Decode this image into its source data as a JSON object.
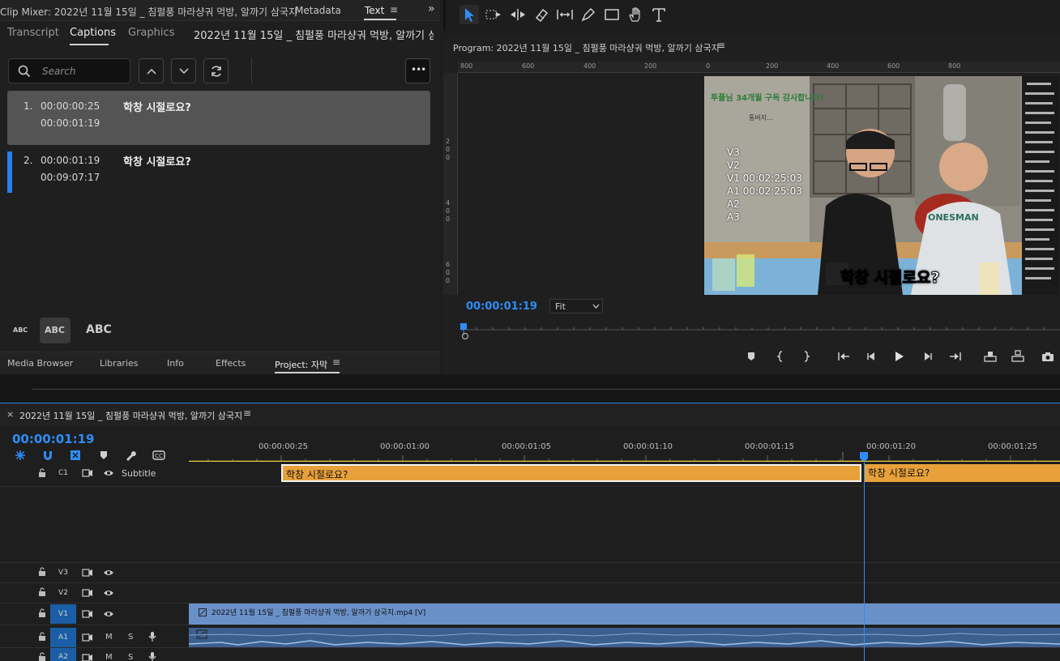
{
  "top_tabs": {
    "clip_mixer": "Clip Mixer: 2022년 11월 15일 _ 침펄풍 마라샹궈 먹방, 알까기 삼국지",
    "metadata": "Metadata",
    "text": "Text",
    "menu_icon": "≡",
    "expand_icon": "»"
  },
  "text_panel": {
    "tabs": [
      "Transcript",
      "Captions",
      "Graphics"
    ],
    "sequence_title": "2022년 11월 15일 _ 침펄풍 마라샹궈 먹방, 알까기 삼...",
    "search_placeholder": "Search",
    "captions": [
      {
        "num": "1.",
        "in": "00:00:00:25",
        "out": "00:00:01:19",
        "text": "학창 시절로요?"
      },
      {
        "num": "2.",
        "in": "00:00:01:19",
        "out": "00:09:07:17",
        "text": "학창 시절로요?"
      }
    ],
    "abc_sizes": [
      "ABC",
      "ABC",
      "ABC"
    ],
    "more": "•••"
  },
  "bottom_tabs": [
    "Media Browser",
    "Libraries",
    "Info",
    "Effects",
    "Project: 자막"
  ],
  "program": {
    "title": "Program: 2022년 11월 15일 _ 침펄풍 마라샹궈 먹방, 알까기 삼국지",
    "ruler_top": [
      "800",
      "600",
      "400",
      "200",
      "0",
      "200",
      "400",
      "600",
      "800"
    ],
    "ruler_left": [
      "2",
      "0",
      "0",
      "4",
      "0",
      "0",
      "6",
      "0",
      "0"
    ],
    "timecode": "00:00:01:19",
    "fit": "Fit",
    "overlay_lines": [
      "V3",
      "V2",
      "V1 00:02:25:03",
      "A1 00:02:25:03",
      "A2",
      "A3"
    ],
    "video_caption": "학창 시절로요?",
    "video_banner": "투플님 34개월 구독 감사합니다!",
    "video_banner_sub": "통버지...",
    "shirt_text": "ONESMAN"
  },
  "timeline": {
    "title": "2022년 11월 15일 _ 침펄풍 마라샹궈 먹방, 알까기 삼국지",
    "close": "×",
    "menu": "≡",
    "timecode": "00:00:01:19",
    "ruler_labels": [
      "00:00:00:25",
      "00:00:01:00",
      "00:00:01:05",
      "00:00:01:10",
      "00:00:01:15",
      "00:00:01:20",
      "00:00:01:25"
    ],
    "subtitle_track": {
      "id": "C1",
      "name": "Subtitle"
    },
    "caption_clips": [
      "학창 시절로요?",
      "학창 시절로요?"
    ],
    "video_tracks": [
      "V3",
      "V2",
      "V1"
    ],
    "audio_tracks": [
      "A1",
      "A2"
    ],
    "video_clip": "2022년 11월 15일 _ 침펄풍 마라샹궈 먹방, 알까기 삼국지.mp4 [V]",
    "mute": "M",
    "solo": "S"
  },
  "colors": {
    "accent": "#2e8df7",
    "caption_clip": "#e8a13a",
    "video_clip": "#6a90c8"
  }
}
